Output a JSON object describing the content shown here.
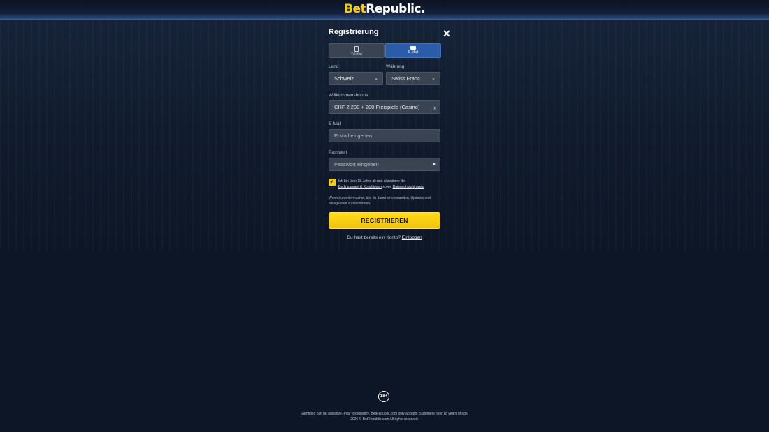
{
  "brand": {
    "part1": "Bet",
    "part2": "Republic."
  },
  "modal": {
    "title": "Registrierung",
    "close_icon": "✕",
    "tabs": [
      {
        "label": "Telefon",
        "icon": "phone-icon"
      },
      {
        "label": "E-Mail",
        "icon": "mail-icon",
        "active": true
      }
    ],
    "country": {
      "label": "Land",
      "value": "Schweiz"
    },
    "currency": {
      "label": "Währung",
      "value": "Swiss Franc"
    },
    "bonus": {
      "label": "Willkommensbonus",
      "value": "CHF 2.200 + 200 Freispiele (Casino)"
    },
    "email": {
      "label": "E-Mail",
      "placeholder": "E-Mail eingeben"
    },
    "password": {
      "label": "Passwort",
      "placeholder": "Passwort eingeben"
    },
    "consent": {
      "checked": true,
      "text_before": "Ich bin über 18 Jahre alt und akzeptiere die",
      "terms_link": "Bedingungen & Konditionen",
      "text_middle": "sowie",
      "privacy_link": "Datenschutzhinweis"
    },
    "info_text": "Wenn du weitermachst, bist du damit einverstanden, Updates und Neuigkeiten zu bekommen.",
    "register_button": "REGISTRIEREN",
    "login_prompt": "Du hast bereits ein Konto?",
    "login_link": "Einloggen"
  },
  "footer": {
    "age_badge": "18+",
    "line1": "Gambling can be addictive. Play responsibly. BetRepublic.com only accepts customers over 18 years of age.",
    "line2": "2026 © BetRepublic.com All rights reserved."
  },
  "colors": {
    "accent": "#f5cf17",
    "active_tab": "#2a5ca8",
    "background": "#0d1626"
  }
}
